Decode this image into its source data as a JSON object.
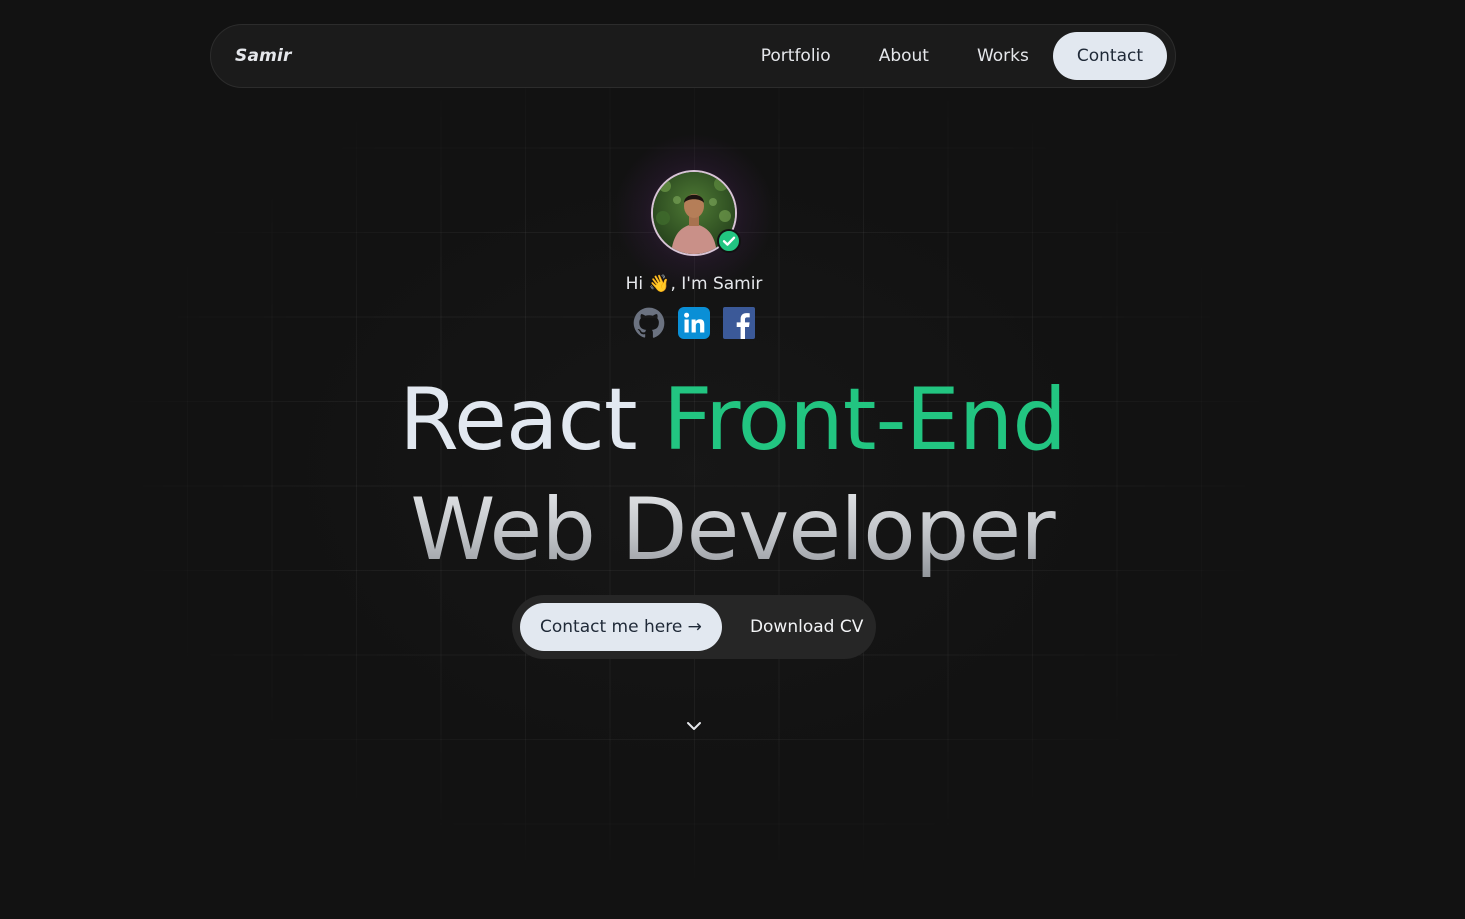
{
  "navbar": {
    "brand": "Samir",
    "links": [
      {
        "label": "Portfolio",
        "active": false
      },
      {
        "label": "About",
        "active": false
      },
      {
        "label": "Works",
        "active": false
      },
      {
        "label": "Contact",
        "active": true
      }
    ]
  },
  "hero": {
    "greeting_prefix": "Hi",
    "greeting_emoji": "👋",
    "greeting_suffix": ", I'm Samir",
    "socials": [
      {
        "icon": "github-icon"
      },
      {
        "icon": "linkedin-icon"
      },
      {
        "icon": "facebook-icon"
      }
    ],
    "headline_word1": "React",
    "headline_accent": "Front-End",
    "headline_line2": "Web Developer",
    "primary_button": "Contact me here →",
    "secondary_button": "Download CV"
  },
  "colors": {
    "background": "#121212",
    "accent": "#22c581",
    "button_light": "#e2e8f0",
    "linkedin": "#0a8fd6",
    "facebook": "#3b5998"
  }
}
